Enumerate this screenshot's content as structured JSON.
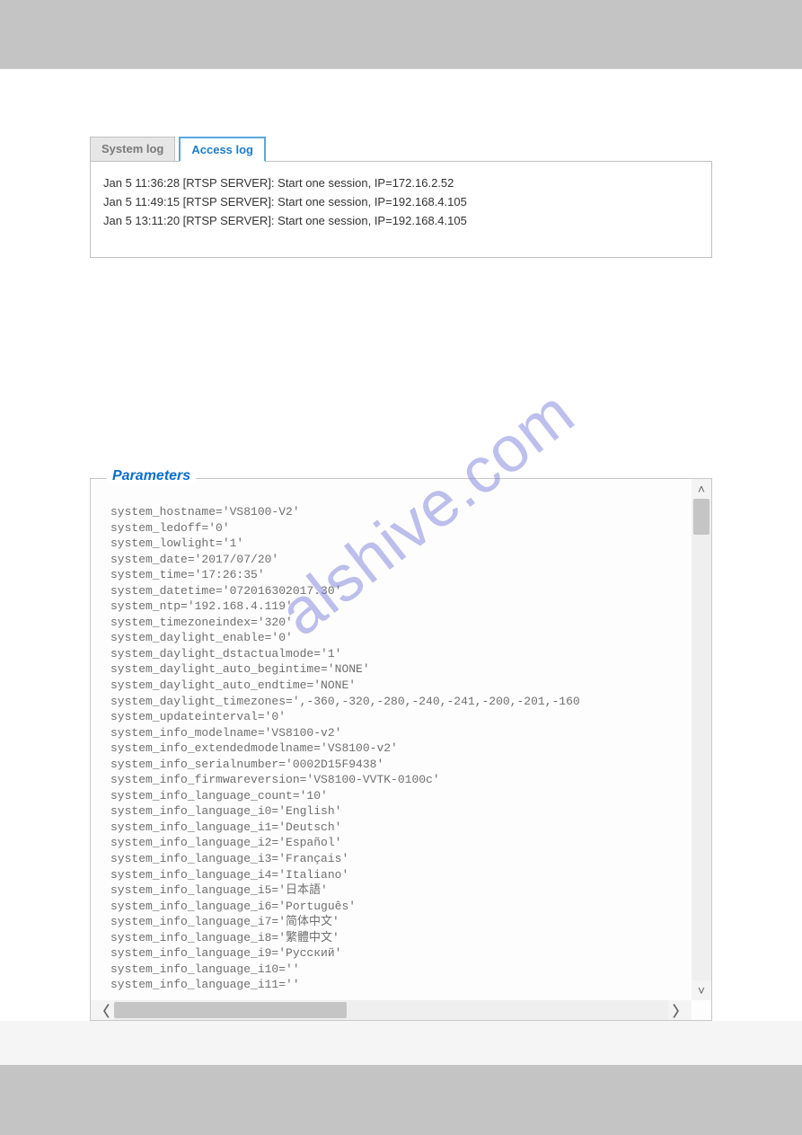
{
  "watermark": "alshive.com",
  "tabs": {
    "system_log": "System log",
    "access_log": "Access log"
  },
  "log_lines": [
    "Jan 5 11:36:28 [RTSP SERVER]: Start one session, IP=172.16.2.52",
    "Jan 5 11:49:15 [RTSP SERVER]: Start one session, IP=192.168.4.105",
    "Jan 5 13:11:20 [RTSP SERVER]: Start one session, IP=192.168.4.105"
  ],
  "parameters": {
    "legend": "Parameters",
    "lines": [
      "system_hostname='VS8100-V2'",
      "system_ledoff='0'",
      "system_lowlight='1'",
      "system_date='2017/07/20'",
      "system_time='17:26:35'",
      "system_datetime='072016302017.30'",
      "system_ntp='192.168.4.119'",
      "system_timezoneindex='320'",
      "system_daylight_enable='0'",
      "system_daylight_dstactualmode='1'",
      "system_daylight_auto_begintime='NONE'",
      "system_daylight_auto_endtime='NONE'",
      "system_daylight_timezones=',-360,-320,-280,-240,-241,-200,-201,-160",
      "system_updateinterval='0'",
      "system_info_modelname='VS8100-v2'",
      "system_info_extendedmodelname='VS8100-v2'",
      "system_info_serialnumber='0002D15F9438'",
      "system_info_firmwareversion='VS8100-VVTK-0100c'",
      "system_info_language_count='10'",
      "system_info_language_i0='English'",
      "system_info_language_i1='Deutsch'",
      "system_info_language_i2='Español'",
      "system_info_language_i3='Français'",
      "system_info_language_i4='Italiano'",
      "system_info_language_i5='日本語'",
      "system_info_language_i6='Português'",
      "system_info_language_i7='简体中文'",
      "system_info_language_i8='繁體中文'",
      "system_info_language_i9='Русский'",
      "system_info_language_i10=''",
      "system_info_language_i11=''"
    ]
  }
}
